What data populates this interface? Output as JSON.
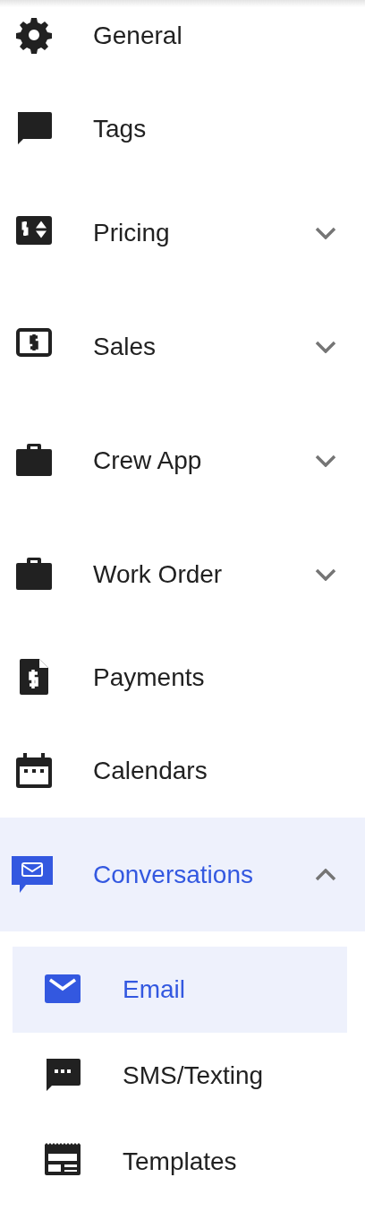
{
  "sidebar": {
    "items": [
      {
        "label": "General",
        "kind": "link",
        "selected": false
      },
      {
        "label": "Tags",
        "kind": "link",
        "selected": false
      },
      {
        "label": "Pricing",
        "kind": "group",
        "selected": false,
        "expanded": false
      },
      {
        "label": "Sales",
        "kind": "group",
        "selected": false,
        "expanded": false
      },
      {
        "label": "Crew App",
        "kind": "group",
        "selected": false,
        "expanded": false
      },
      {
        "label": "Work Order",
        "kind": "group",
        "selected": false,
        "expanded": false
      },
      {
        "label": "Payments",
        "kind": "link",
        "selected": false
      },
      {
        "label": "Calendars",
        "kind": "link",
        "selected": false
      },
      {
        "label": "Conversations",
        "kind": "group",
        "selected": true,
        "expanded": true,
        "children": [
          {
            "label": "Email",
            "selected": true
          },
          {
            "label": "SMS/Texting",
            "selected": false
          },
          {
            "label": "Templates",
            "selected": false
          }
        ]
      }
    ]
  }
}
